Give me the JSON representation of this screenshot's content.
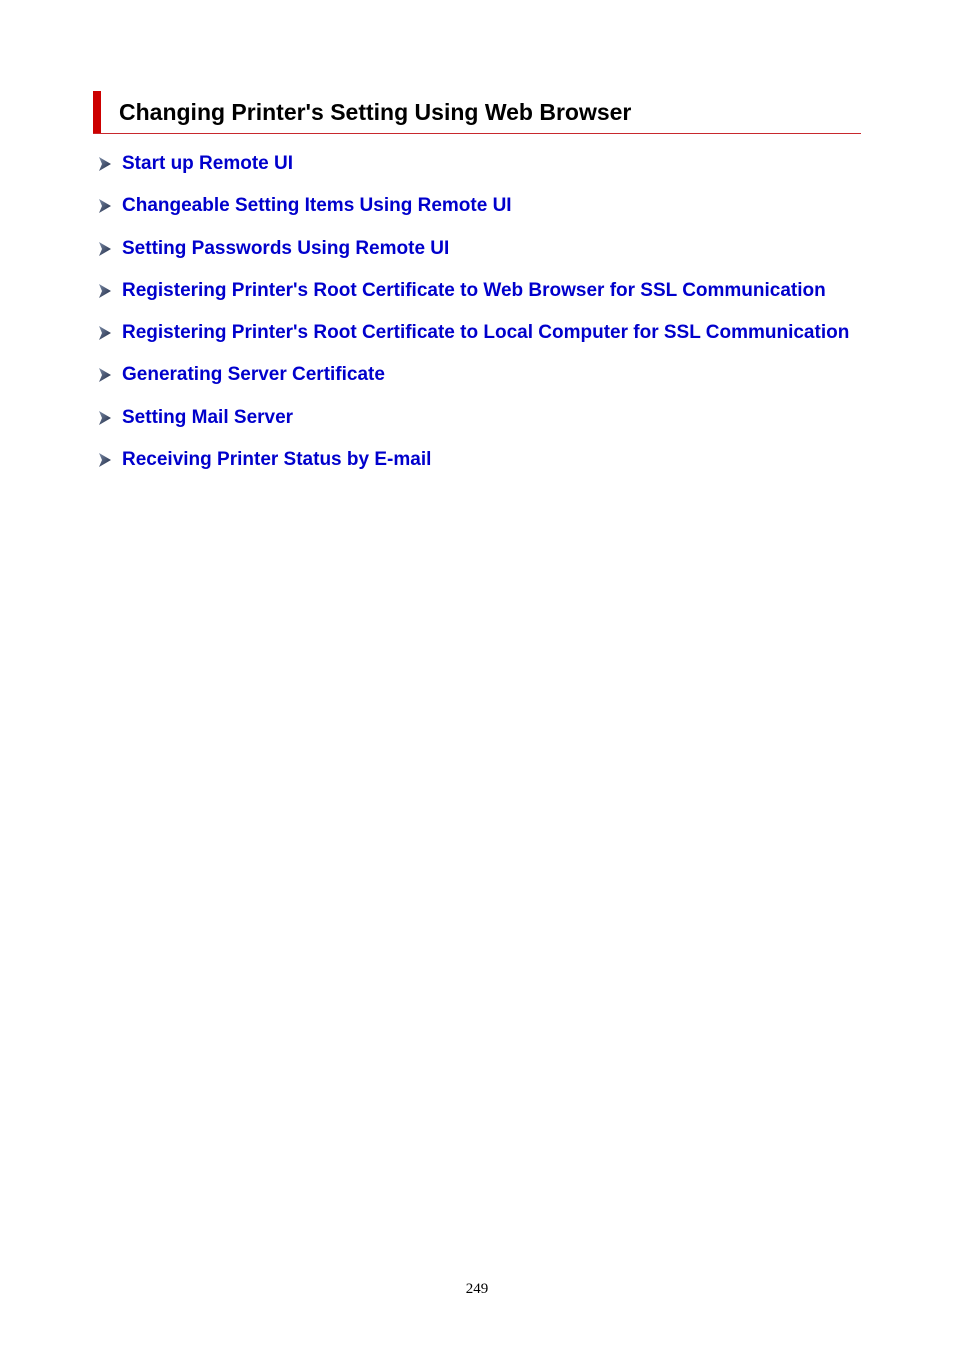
{
  "heading": {
    "title": "Changing Printer's Setting Using Web Browser"
  },
  "links": [
    {
      "label": "Start up Remote UI",
      "icon": "arrow-right-icon"
    },
    {
      "label": "Changeable Setting Items Using Remote UI",
      "icon": "arrow-right-icon"
    },
    {
      "label": "Setting Passwords Using Remote UI",
      "icon": "arrow-right-icon"
    },
    {
      "label": "Registering Printer's Root Certificate to Web Browser for SSL Communication",
      "icon": "arrow-right-icon"
    },
    {
      "label": "Registering Printer's Root Certificate to Local Computer for SSL Communication",
      "icon": "arrow-right-icon"
    },
    {
      "label": "Generating Server Certificate",
      "icon": "arrow-right-icon"
    },
    {
      "label": "Setting Mail Server",
      "icon": "arrow-right-icon"
    },
    {
      "label": "Receiving Printer Status by E-mail",
      "icon": "arrow-right-icon"
    }
  ],
  "footer": {
    "page_number": "249"
  },
  "colors": {
    "accent_red": "#cc0000",
    "link_blue": "#0000cc"
  }
}
